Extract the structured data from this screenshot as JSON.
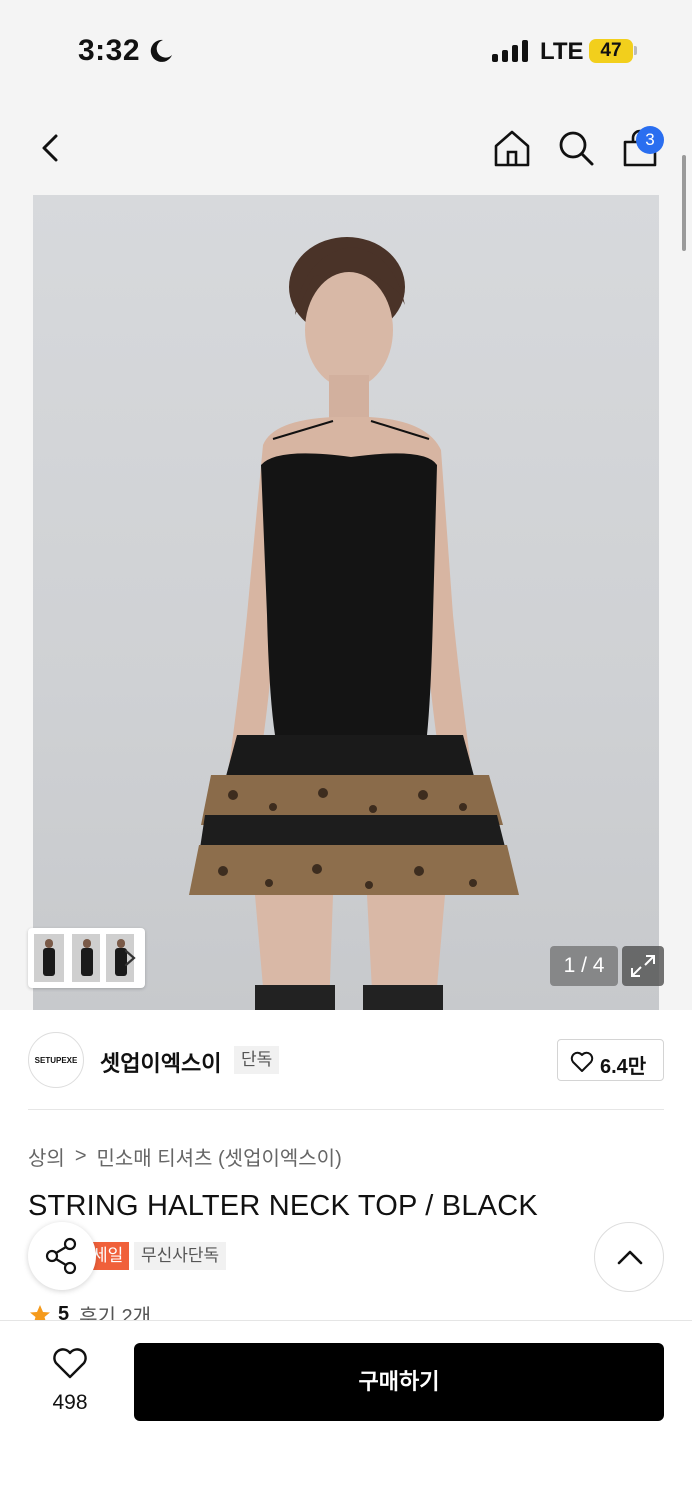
{
  "status_bar": {
    "time": "3:32",
    "network": "LTE",
    "battery": "47",
    "battery_color": "#f2cf1c"
  },
  "nav": {
    "cart_count": "3",
    "badge_color": "#2a6ef0",
    "icons": [
      "back-icon",
      "home-icon",
      "search-icon",
      "cart-icon"
    ]
  },
  "gallery": {
    "counter": "1 / 4"
  },
  "brand": {
    "logo_text": "SETUPEXE",
    "name": "셋업이엑스이",
    "tag": "단독",
    "likes": "6.4만"
  },
  "breadcrumb": {
    "level1": "상의",
    "separator": ">",
    "level2": "민소매 티셔츠 (셋업이엑스이)"
  },
  "product": {
    "title": "STRING HALTER NECK TOP / BLACK",
    "tag_sale": "세일",
    "tag_exclusive": "무신사단독",
    "rating_score": "5",
    "reviews": "후기 2개"
  },
  "bottom_bar": {
    "wish_count": "498",
    "buy_label": "구매하기"
  }
}
